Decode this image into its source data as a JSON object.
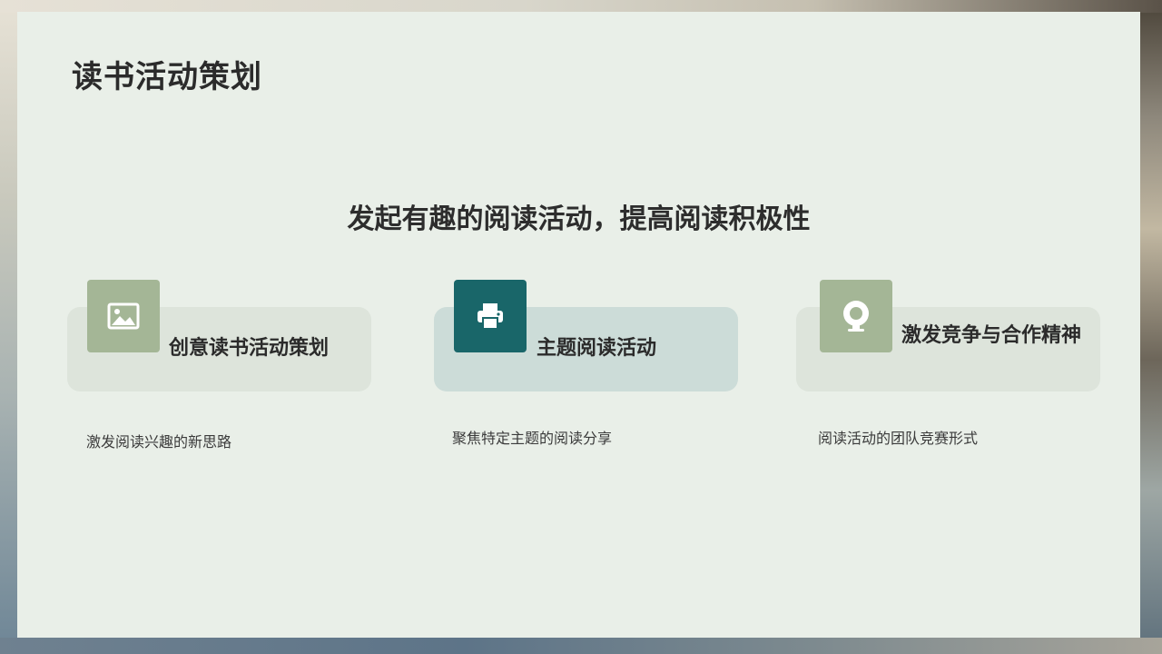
{
  "page": {
    "title": "读书活动策划",
    "subtitle": "发起有趣的阅读活动，提高阅读积极性"
  },
  "cards": [
    {
      "icon": "image-icon",
      "title": "创意读书活动策划",
      "description": "激发阅读兴趣的新思路"
    },
    {
      "icon": "printer-icon",
      "title": "主题阅读活动",
      "description": "聚焦特定主题的阅读分享"
    },
    {
      "icon": "webcam-icon",
      "title": "激发竞争与合作精神",
      "description": "阅读活动的团队竞赛形式"
    }
  ],
  "colors": {
    "slide_background": "#e9efe8",
    "card_background": "#dde4db",
    "card_background_active": "#ccdcd8",
    "icon_box": "#a4b696",
    "icon_box_active": "#196669",
    "text_dark": "#2b2b2b"
  }
}
